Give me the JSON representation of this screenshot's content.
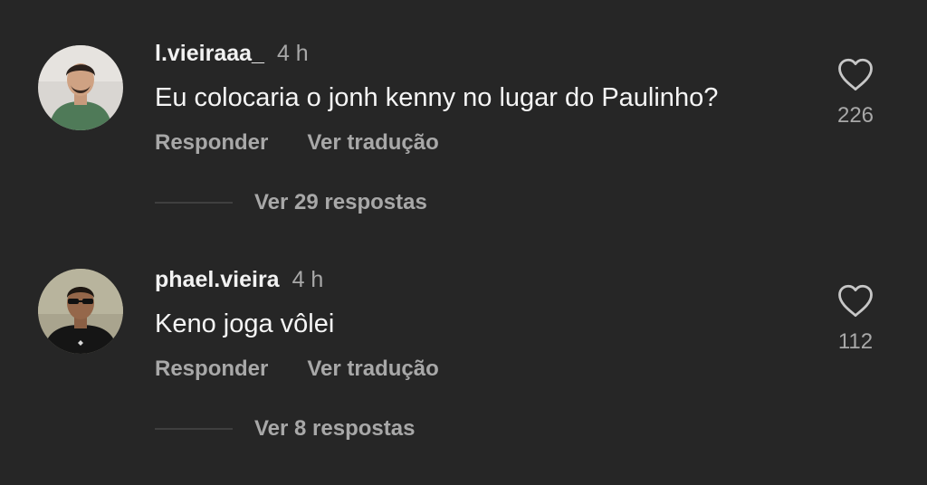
{
  "comments": [
    {
      "username": "l.vieiraaa_",
      "time": "4 h",
      "text": "Eu colocaria o jonh kenny no lugar do Paulinho?",
      "reply_label": "Responder",
      "translate_label": "Ver tradução",
      "view_replies_label": "Ver 29 respostas",
      "like_count": "226",
      "avatar_icon": "profile-photo-icon",
      "like_icon": "heart-outline-icon"
    },
    {
      "username": "phael.vieira",
      "time": "4 h",
      "text": "Keno joga vôlei",
      "reply_label": "Responder",
      "translate_label": "Ver tradução",
      "view_replies_label": "Ver 8 respostas",
      "like_count": "112",
      "avatar_icon": "profile-photo-icon",
      "like_icon": "heart-outline-icon"
    }
  ],
  "colors": {
    "background": "#262626",
    "primary_text": "#f5f5f5",
    "secondary_text": "#a8a8a8",
    "divider": "#3f3f3f"
  }
}
